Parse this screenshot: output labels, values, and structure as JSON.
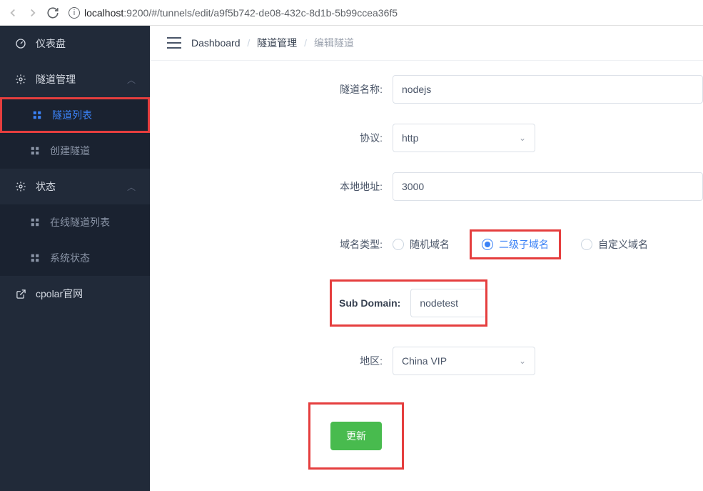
{
  "browser": {
    "url_host": "localhost",
    "url_port": ":9200",
    "url_path": "/#/tunnels/edit/a9f5b742-de08-432c-8d1b-5b99ccea36f5"
  },
  "sidebar": {
    "dashboard": "仪表盘",
    "tunnel_mgmt": "隧道管理",
    "tunnel_list": "隧道列表",
    "create_tunnel": "创建隧道",
    "status": "状态",
    "online_tunnels": "在线隧道列表",
    "system_status": "系统状态",
    "cpolar_site": "cpolar官网"
  },
  "breadcrumb": {
    "dashboard": "Dashboard",
    "tunnel_mgmt": "隧道管理",
    "edit_tunnel": "编辑隧道"
  },
  "form": {
    "tunnel_name_label": "隧道名称:",
    "tunnel_name_value": "nodejs",
    "protocol_label": "协议:",
    "protocol_value": "http",
    "local_addr_label": "本地地址:",
    "local_addr_value": "3000",
    "domain_type_label": "域名类型:",
    "domain_random": "随机域名",
    "domain_subdomain": "二级子域名",
    "domain_custom": "自定义域名",
    "subdomain_label": "Sub Domain:",
    "subdomain_value": "nodetest",
    "region_label": "地区:",
    "region_value": "China VIP",
    "submit_label": "更新"
  }
}
